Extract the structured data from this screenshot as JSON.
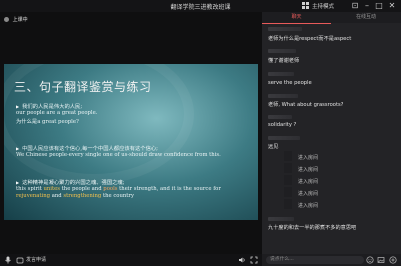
{
  "titlebar": {
    "title": "翻译学院三进教改班课",
    "mode_label": "主持模式"
  },
  "presenter": {
    "label": "上课中"
  },
  "slide": {
    "heading": "三、句子翻译鉴赏与练习",
    "items": [
      {
        "zh": "我们的人民是伟大的人民;",
        "en": "our people are a great people.",
        "zh2": "为什么是a great people?"
      },
      {
        "zh": "中国人民应该有这个信心,每一个中国人都应该有这个信心;",
        "en": "We Chinese people-every single one of us-should draw confidence from this."
      },
      {
        "zh": "这种精神是凝心聚力的兴国之魂、强国之魂;",
        "en_parts": [
          {
            "text": "this spirit ",
            "hl": ""
          },
          {
            "text": "unites",
            "hl": "hl"
          },
          {
            "text": " the people and ",
            "hl": ""
          },
          {
            "text": "pools",
            "hl": "hl2"
          },
          {
            "text": " their strength, and it is the source for",
            "hl": ""
          }
        ],
        "en_parts2": [
          {
            "text": "rejuvenating",
            "hl": "hl"
          },
          {
            "text": " and ",
            "hl": ""
          },
          {
            "text": "strengthening",
            "hl": "hl"
          },
          {
            "text": " the country",
            "hl": ""
          }
        ]
      }
    ]
  },
  "bottombar": {
    "label": "发言申请"
  },
  "panel": {
    "tabs": [
      "聊天",
      "在线互动"
    ],
    "messages": [
      {
        "text": "老师为什么是respect而不是aspect"
      },
      {
        "text": "懂了谢谢老师"
      },
      {
        "text": "serve the people"
      },
      {
        "text": "老师, What about grassroots?"
      },
      {
        "text": "solidarity ?"
      },
      {
        "text": "远见"
      },
      {
        "text": "九十度的和去一半的那煮不多的意思吧"
      }
    ],
    "join_text": "进入房间",
    "input_placeholder": "说点什么..."
  },
  "colors": {
    "accent": "#e85a5a",
    "highlight": "#f2c14e",
    "highlight2": "#f5a35a"
  }
}
